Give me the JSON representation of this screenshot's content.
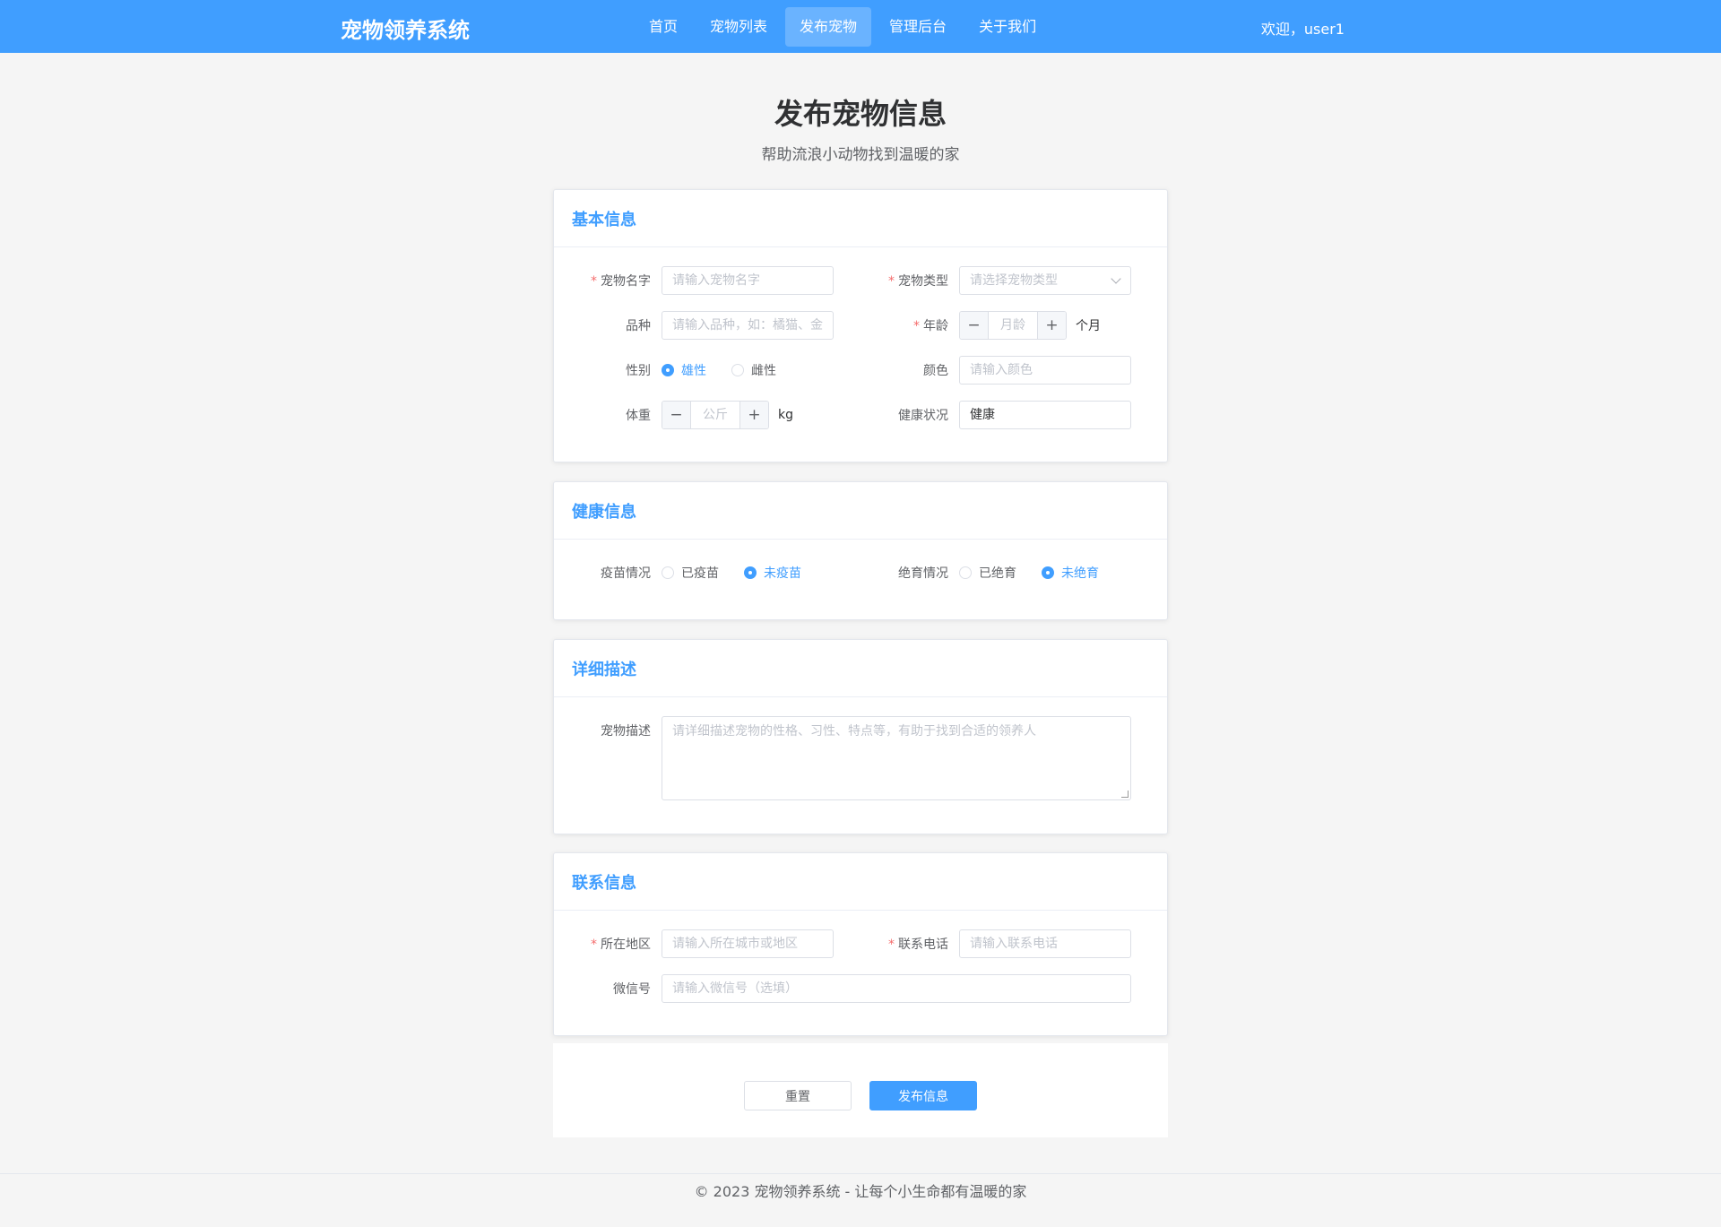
{
  "header": {
    "brand": "宠物领养系统",
    "nav": [
      {
        "label": "首页"
      },
      {
        "label": "宠物列表"
      },
      {
        "label": "发布宠物"
      },
      {
        "label": "管理后台"
      },
      {
        "label": "关于我们"
      }
    ],
    "active_nav": "发布宠物",
    "welcome": "欢迎，user1"
  },
  "page": {
    "title": "发布宠物信息",
    "subtitle": "帮助流浪小动物找到温暖的家"
  },
  "basic": {
    "title": "基本信息",
    "name_label": "宠物名字",
    "name_placeholder": "请输入宠物名字",
    "type_label": "宠物类型",
    "type_placeholder": "请选择宠物类型",
    "breed_label": "品种",
    "breed_placeholder": "请输入品种，如：橘猫、金",
    "age_label": "年龄",
    "age_placeholder": "月龄",
    "age_unit": "个月",
    "gender_label": "性别",
    "gender_options": [
      "雄性",
      "雌性"
    ],
    "gender_selected": "雄性",
    "color_label": "颜色",
    "color_placeholder": "请输入颜色",
    "weight_label": "体重",
    "weight_placeholder": "公斤",
    "weight_unit": "kg",
    "health_label": "健康状况",
    "health_value": "健康"
  },
  "health": {
    "title": "健康信息",
    "vaccine_label": "疫苗情况",
    "vaccine_options": [
      "已疫苗",
      "未疫苗"
    ],
    "vaccine_selected": "未疫苗",
    "neuter_label": "绝育情况",
    "neuter_options": [
      "已绝育",
      "未绝育"
    ],
    "neuter_selected": "未绝育"
  },
  "detail": {
    "title": "详细描述",
    "desc_label": "宠物描述",
    "desc_placeholder": "请详细描述宠物的性格、习性、特点等，有助于找到合适的领养人"
  },
  "contact": {
    "title": "联系信息",
    "area_label": "所在地区",
    "area_placeholder": "请输入所在城市或地区",
    "phone_label": "联系电话",
    "phone_placeholder": "请输入联系电话",
    "wechat_label": "微信号",
    "wechat_placeholder": "请输入微信号（选填）"
  },
  "actions": {
    "reset": "重置",
    "submit": "发布信息"
  },
  "footer": {
    "text": "© 2023 宠物领养系统 - 让每个小生命都有温暖的家"
  },
  "colors": {
    "primary": "#409eff",
    "required": "#f56c6c",
    "background": "#f5f5f5"
  },
  "icons": {
    "select_arrow": "chevron-down-icon",
    "minus": "minus-icon",
    "plus": "plus-icon"
  }
}
